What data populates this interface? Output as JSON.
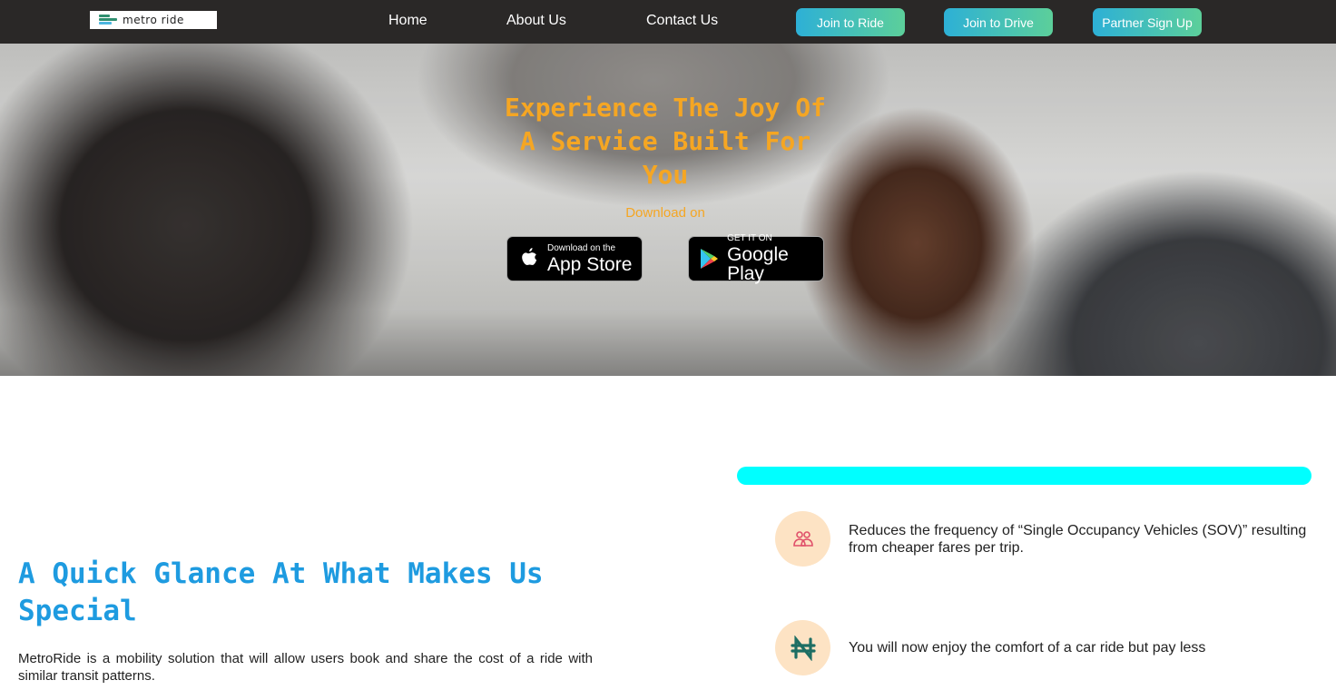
{
  "nav": {
    "logo_text": "metro ride",
    "links": [
      "Home",
      "About Us",
      "Contact Us"
    ],
    "buttons": [
      "Join to Ride",
      "Join to Drive",
      "Partner Sign Up"
    ]
  },
  "hero": {
    "title": "Experience The Joy Of A Service Built For You",
    "subtitle": "Download on",
    "app_store": {
      "small": "Download on the",
      "big": "App Store"
    },
    "google_play": {
      "small": "GET IT ON",
      "big": "Google Play"
    }
  },
  "section": {
    "title": "A Quick Glance At What Makes Us Special",
    "body": "MetroRide is a mobility solution that will allow users book and share the cost of a ride with similar transit patterns."
  },
  "features": [
    {
      "icon": "people-icon",
      "text": "Reduces the frequency of “Single Occupancy Vehicles (SOV)” resulting from cheaper fares per trip."
    },
    {
      "icon": "naira-icon",
      "text": "You will now enjoy the comfort of a car ride but pay less"
    }
  ],
  "colors": {
    "navbar": "#2a2827",
    "accent_orange": "#f5a623",
    "title_blue": "#1e9be0",
    "cyan_bar": "#00ffff",
    "icon_bg": "#fde3c4",
    "people_icon": "#e0506a",
    "naira_icon": "#1d6e63"
  }
}
